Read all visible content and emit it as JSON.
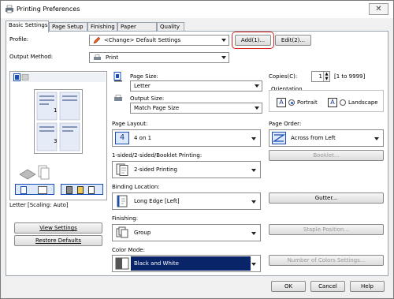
{
  "window": {
    "title": "Printing Preferences",
    "close_glyph": "✕"
  },
  "tabs": [
    "Basic Settings",
    "Page Setup",
    "Finishing",
    "Paper Source",
    "Quality"
  ],
  "profile": {
    "label": "Profile:",
    "value": "<Change> Default Settings",
    "add_button": "Add(1)...",
    "edit_button": "Edit(2)..."
  },
  "output_method": {
    "label": "Output Method:",
    "value": "Print"
  },
  "preview": {
    "status": "Letter [Scaling: Auto]",
    "page_numbers": [
      "1",
      "3"
    ]
  },
  "side_buttons": {
    "view_settings": "View Settings",
    "restore_defaults": "Restore Defaults"
  },
  "page_size": {
    "label": "Page Size:",
    "value": "Letter"
  },
  "output_size": {
    "label": "Output Size:",
    "value": "Match Page Size"
  },
  "copies": {
    "label": "Copies(C):",
    "value": "1",
    "range": "[1 to 9999]"
  },
  "orientation": {
    "label": "Orientation",
    "portrait": "Portrait",
    "landscape": "Landscape",
    "selected": "portrait"
  },
  "page_layout": {
    "label": "Page Layout:",
    "value": "4 on 1",
    "icon_text": "4"
  },
  "page_order": {
    "label": "Page Order:",
    "value": "Across from Left"
  },
  "booklet_button": "Booklet...",
  "printing_mode": {
    "label": "1-sided/2-sided/Booklet Printing:",
    "value": "2-sided Printing"
  },
  "binding_location": {
    "label": "Binding Location:",
    "value": "Long Edge [Left]"
  },
  "gutter_button": "Gutter...",
  "finishing": {
    "label": "Finishing:",
    "value": "Group"
  },
  "staple_button": "Staple Position...",
  "color_mode": {
    "label": "Color Mode:",
    "value": "Black and White"
  },
  "colors_button": "Number of Colors Settings...",
  "footer": {
    "ok": "OK",
    "cancel": "Cancel",
    "help": "Help"
  },
  "colors": {
    "accent_blue": "#1a4fb8",
    "highlight_red": "#d82020",
    "selection": "#0a246a"
  }
}
